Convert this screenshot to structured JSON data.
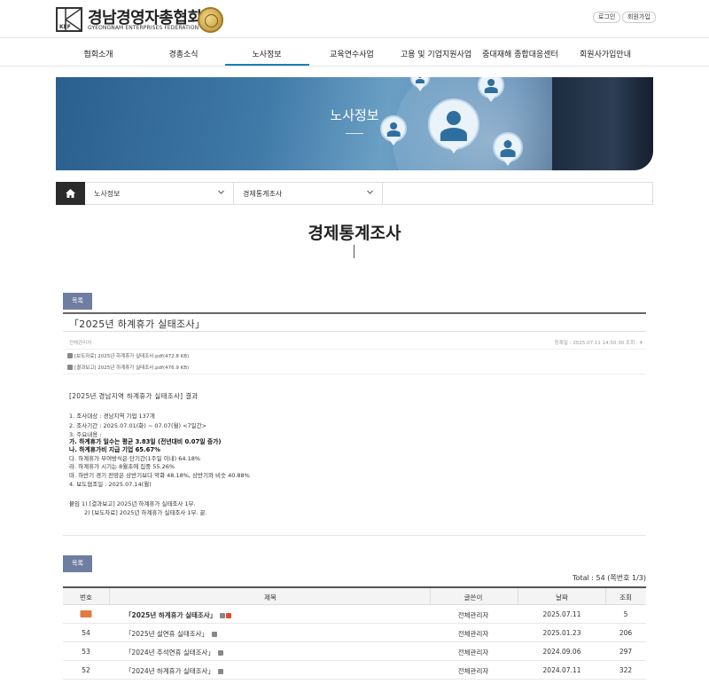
{
  "header": {
    "logo_mark": "KEF",
    "logo_title": "경남경영자총협회",
    "logo_sub": "GYEONGNAM ENTERPRISES FEDERATION",
    "login_label": "로그인",
    "join_label": "회원가입"
  },
  "nav": {
    "items": [
      "협회소개",
      "경총소식",
      "노사정보",
      "교육연수사업",
      "고용 및 기업지원사업",
      "중대재해 종합대응센터",
      "회원사가입안내"
    ],
    "active": "노사정보"
  },
  "banner": {
    "title": "노사정보"
  },
  "breadcrumb": {
    "level1": "노사정보",
    "level2": "경제통계조사"
  },
  "page": {
    "title": "경제통계조사"
  },
  "post": {
    "list_label": "목록",
    "subject": "「2025년 하계휴가 실태조사」",
    "author": "전체관리자",
    "meta": "등록일 : 2025.07.11 14:50:30  조회 : 4",
    "attachments": [
      "[보도자료] 2025년 하계휴가 실태조사.pdf(472.8 KB)",
      "[결과보고] 2025년 하계휴가 실태조사.pdf(476.9 KB)"
    ],
    "body": {
      "heading": "[2025년 경남지역 하계휴가 실태조사] 결과",
      "l1": "1. 조사대상 : 경남지역 기업 137개",
      "l2": "2. 조사기간 : 2025.07.01(화) ~ 07.07(월) <7일간>",
      "l3": "3. 주요내용 :",
      "l4": "가. 하계휴가 일수는 평균 3.83일 (전년대비 0.07일 증가)",
      "l5": "나. 하계휴가비 지급 기업 65.67%",
      "l6": "다. 하계휴가 부여방식은 단기간(1주일 이내) 64.18%",
      "l7": "라. 하계휴가 시기는 8월초에 집중 55.26%",
      "l8": "마. 하반기 경기 전망은 상반기보다 악화 48.18%, 상반기와 비슷 40.88%",
      "l9": "4. 보도협조일 : 2025.07.14(월)",
      "att1": "붙임  1) [결과보고] 2025년 하계휴가 실태조사 1부.",
      "att2": "2) [보도자료] 2025년 하계휴가 실태조사 1부.  끝."
    }
  },
  "list": {
    "list_label": "목록",
    "total": "Total : 54 (쪽번호 1/3)",
    "headers": [
      "번호",
      "제목",
      "글쓴이",
      "날짜",
      "조회"
    ],
    "rows": [
      {
        "num": "",
        "notice": true,
        "subject": "「2025년 하계휴가 실태조사」",
        "author": "전체관리자",
        "date": "2025.07.11",
        "views": "5"
      },
      {
        "num": "54",
        "notice": false,
        "subject": "「2025년 설연휴 실태조사」",
        "author": "전체관리자",
        "date": "2025.01.23",
        "views": "206"
      },
      {
        "num": "53",
        "notice": false,
        "subject": "「2024년 추석연휴 실태조사」",
        "author": "전체관리자",
        "date": "2024.09.06",
        "views": "297"
      },
      {
        "num": "52",
        "notice": false,
        "subject": "「2024년 하계휴가 실태조사」",
        "author": "전체관리자",
        "date": "2024.07.11",
        "views": "322"
      }
    ]
  },
  "colors": {
    "accent": "#1a7fb8",
    "list_button": "#6e7ea0",
    "notice_badge": "#e37b43"
  }
}
